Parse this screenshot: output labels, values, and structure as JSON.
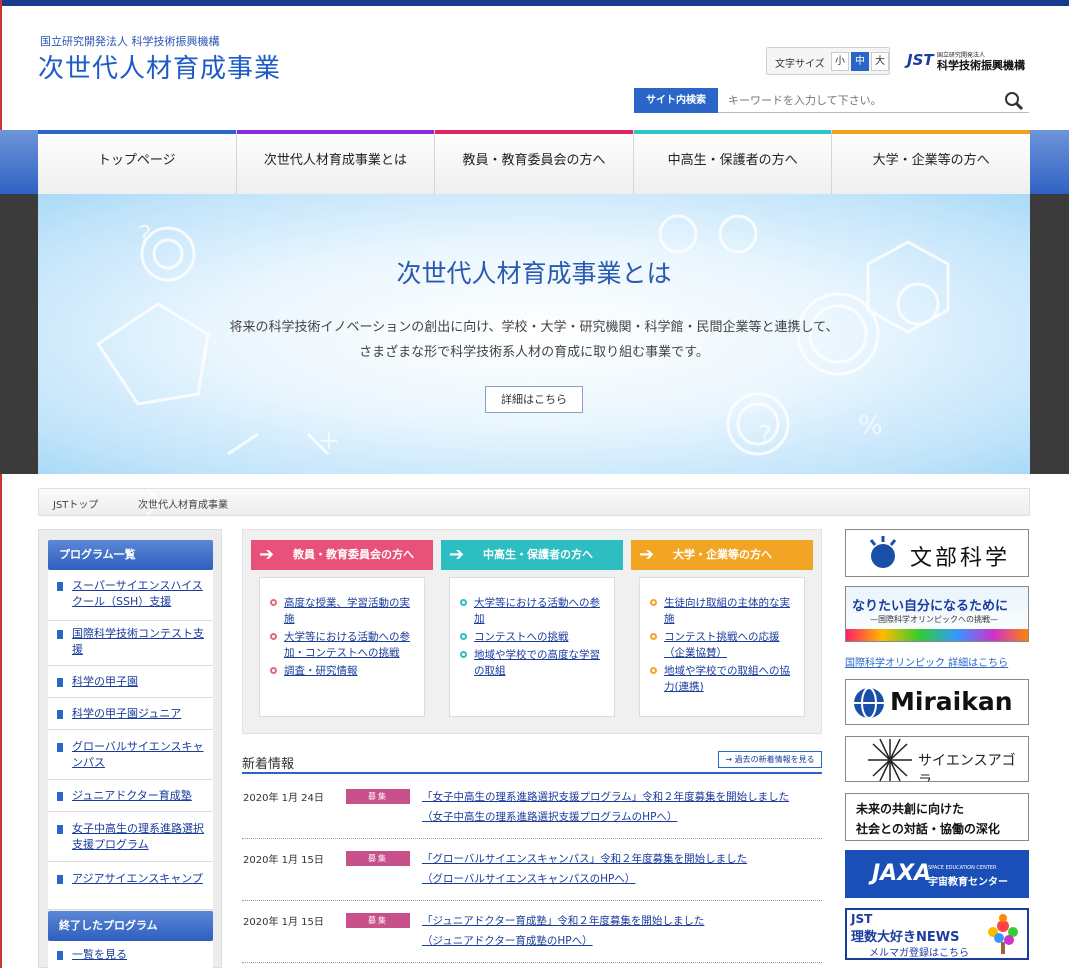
{
  "header": {
    "org_name": "国立研究開発法人 科学技術振興機構",
    "site_title": "次世代人材育成事業",
    "font_size_label": "文字サイズ",
    "font_sizes": [
      "小",
      "中",
      "大"
    ],
    "font_size_selected": "中",
    "jst_logo_mark": "JST",
    "jst_logo_small": "国立研究開発法人",
    "jst_logo_name": "科学技術振興機構",
    "search_button": "サイト内検索",
    "search_placeholder": "キーワードを入力して下さい。"
  },
  "nav": {
    "items": [
      {
        "label": "トップページ",
        "color": "#2a66c8"
      },
      {
        "label": "次世代人材育成事業とは",
        "color": "#8a2be2"
      },
      {
        "label": "教員・教育委員会の方へ",
        "color": "#e0245e"
      },
      {
        "label": "中高生・保護者の方へ",
        "color": "#2ec4c4"
      },
      {
        "label": "大学・企業等の方へ",
        "color": "#f0a020"
      }
    ]
  },
  "hero": {
    "title": "次世代人材育成事業とは",
    "desc_line1": "将来の科学技術イノベーションの創出に向け、学校・大学・研究機関・科学館・民間企業等と連携して、",
    "desc_line2": "さまざまな形で科学技術系人材の育成に取り組む事業です。",
    "button": "詳細はこちら"
  },
  "breadcrumb": {
    "home": "JSTトップ",
    "current": "次世代人材育成事業"
  },
  "sidebar": {
    "heading": "プログラム一覧",
    "items": [
      "スーパーサイエンスハイスクール（SSH）支援",
      "国際科学技術コンテスト支援",
      "科学の甲子園",
      "科学の甲子園ジュニア",
      "グローバルサイエンスキャンパス",
      "ジュニアドクター育成塾",
      "女子中高生の理系進路選択支援プログラム",
      "アジアサイエンスキャンプ"
    ],
    "ended_heading": "終了したプログラム",
    "ended_items": [
      "一覧を見る"
    ]
  },
  "cards": [
    {
      "title": "教員・教育委員会の方へ",
      "color": "#e8527a",
      "dot_color": "#e06a7e",
      "links": [
        "高度な授業、学習活動の実施",
        "大学等における活動への参加・コンテストへの挑戦",
        "調査・研究情報"
      ]
    },
    {
      "title": "中高生・保護者の方へ",
      "color": "#2cbec0",
      "dot_color": "#2cbec0",
      "links": [
        "大学等における活動への参加",
        "コンテストへの挑戦",
        "地域や学校での高度な学習の取組"
      ]
    },
    {
      "title": "大学・企業等の方へ",
      "color": "#f2a424",
      "dot_color": "#f2a424",
      "links": [
        "生徒向け取組の主体的な実施",
        "コンテスト挑戦への応援（企業協賛）",
        "地域や学校での取組への協力(連携)"
      ]
    }
  ],
  "news": {
    "title": "新着情報",
    "more": "→ 過去の新着情報を見る",
    "items": [
      {
        "date": "2020年  1月 24日",
        "tag": "募集",
        "line1": "「女子中高生の理系進路選択支援プログラム」令和２年度募集を開始しました",
        "line2": "（女子中高生の理系進路選択支援プログラムのHPへ）"
      },
      {
        "date": "2020年 1月 15日",
        "tag": "募集",
        "line1": "「グローバルサイエンスキャンパス」令和２年度募集を開始しました",
        "line2": "（グローバルサイエンスキャンパスのHPへ）"
      },
      {
        "date": "2020年 1月 15日",
        "tag": "募集",
        "line1": "「ジュニアドクター育成塾」令和２年度募集を開始しました",
        "line2": "（ジュニアドクター育成塾のHPへ）"
      }
    ]
  },
  "banners": {
    "mext": "文部科学省",
    "olympic_main": "なりたい自分になるために",
    "olympic_sub": "—国際科学オリンピックへの挑戦—",
    "olympic_link": "国際科学オリンピック 詳細はこちら",
    "miraikan": "Miraikan",
    "agora": "サイエンスアゴラ",
    "future_line1": "未来の共創に向けた",
    "future_line2": "社会との対話・協働の深化",
    "jaxa": "JAXA",
    "jaxa_small": "SPACE EDUCATION CENTER",
    "jaxa_center": "宇宙教育センター",
    "news_line1": "JST",
    "news_line2": "理数大好きNEWS",
    "news_line3": "メルマガ登録はこちら"
  }
}
